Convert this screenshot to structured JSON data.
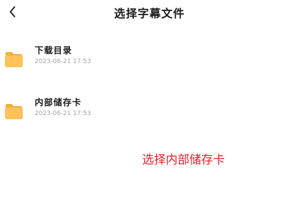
{
  "header": {
    "back_icon": "chevron-left-icon",
    "title": "选择字幕文件"
  },
  "items": [
    {
      "icon": "folder-icon",
      "name": "下载目录",
      "date": "2023-06-21 17:53"
    },
    {
      "icon": "folder-icon",
      "name": "内部储存卡",
      "date": "2023-06-21 17:53"
    }
  ],
  "action": {
    "label": "选择内部储存卡"
  },
  "colors": {
    "folder": "#FFC35A",
    "folder_tab": "#F6AE3E",
    "action_text": "#E0202A",
    "date_text": "#A6A6A6",
    "title_text": "#1A1A1A"
  }
}
